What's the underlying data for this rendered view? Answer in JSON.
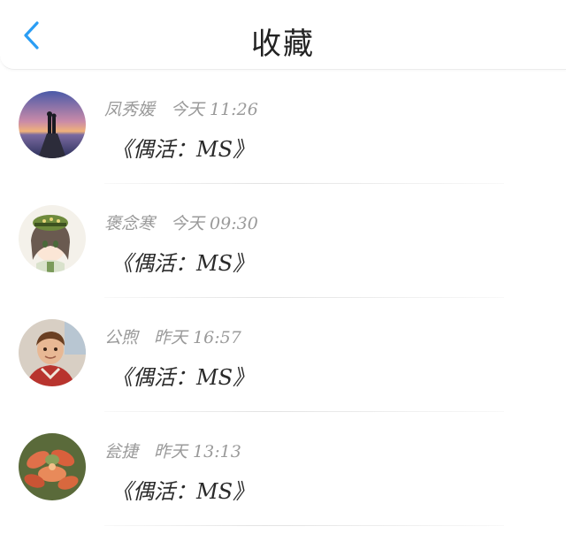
{
  "header": {
    "title": "收藏",
    "back_icon": "chevron-left-icon",
    "accent_color": "#2a9df4"
  },
  "favorites": [
    {
      "name": "凤秀媛",
      "time": "今天 11:26",
      "content": "《偶活：MS》",
      "avatar": "sunset-couple-avatar"
    },
    {
      "name": "褒念寒",
      "time": "今天 09:30",
      "content": "《偶活：MS》",
      "avatar": "anime-girl-avatar"
    },
    {
      "name": "公煦",
      "time": "昨天 16:57",
      "content": "《偶活：MS》",
      "avatar": "child-photo-avatar"
    },
    {
      "name": "瓮捷",
      "time": "昨天 13:13",
      "content": "《偶活：MS》",
      "avatar": "succulent-plant-avatar"
    }
  ]
}
